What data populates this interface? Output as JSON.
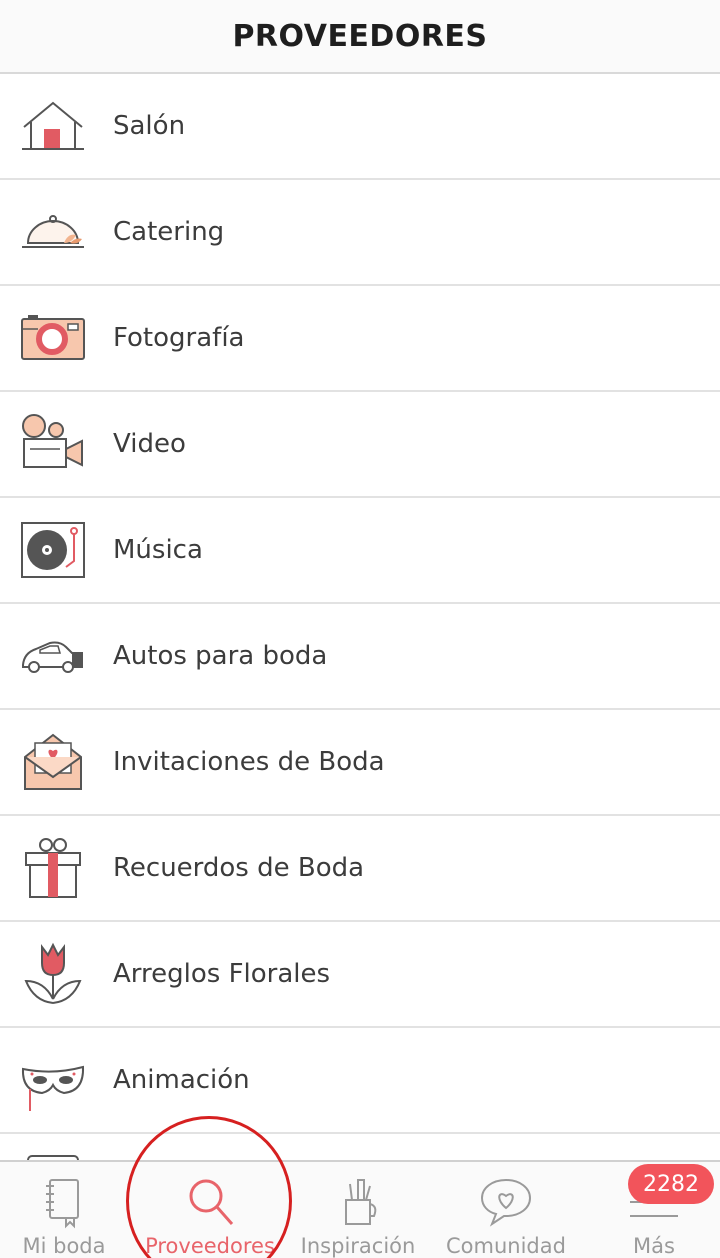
{
  "header": {
    "title": "PROVEEDORES"
  },
  "categories": [
    {
      "label": "Salón",
      "icon": "house-icon"
    },
    {
      "label": "Catering",
      "icon": "food-cloche-icon"
    },
    {
      "label": "Fotografía",
      "icon": "camera-icon"
    },
    {
      "label": "Video",
      "icon": "video-camera-icon"
    },
    {
      "label": "Música",
      "icon": "turntable-icon"
    },
    {
      "label": "Autos para boda",
      "icon": "car-icon"
    },
    {
      "label": "Invitaciones de Boda",
      "icon": "envelope-heart-icon"
    },
    {
      "label": "Recuerdos de Boda",
      "icon": "gift-icon"
    },
    {
      "label": "Arreglos Florales",
      "icon": "tulip-icon"
    },
    {
      "label": "Animación",
      "icon": "mask-icon"
    }
  ],
  "tabbar": {
    "tabs": [
      {
        "label": "Mi boda",
        "icon": "notebook-icon",
        "active": false
      },
      {
        "label": "Proveedores",
        "icon": "search-icon",
        "active": true
      },
      {
        "label": "Inspiración",
        "icon": "pencil-cup-icon",
        "active": false
      },
      {
        "label": "Comunidad",
        "icon": "chat-heart-icon",
        "active": false
      },
      {
        "label": "Más",
        "icon": "menu-icon",
        "active": false
      }
    ],
    "badge": "2282"
  },
  "colors": {
    "accent": "#e8646a",
    "badge": "#f2545b",
    "icon_stroke": "#555555",
    "icon_peach": "#f7c7ad",
    "icon_red": "#e15b63"
  }
}
